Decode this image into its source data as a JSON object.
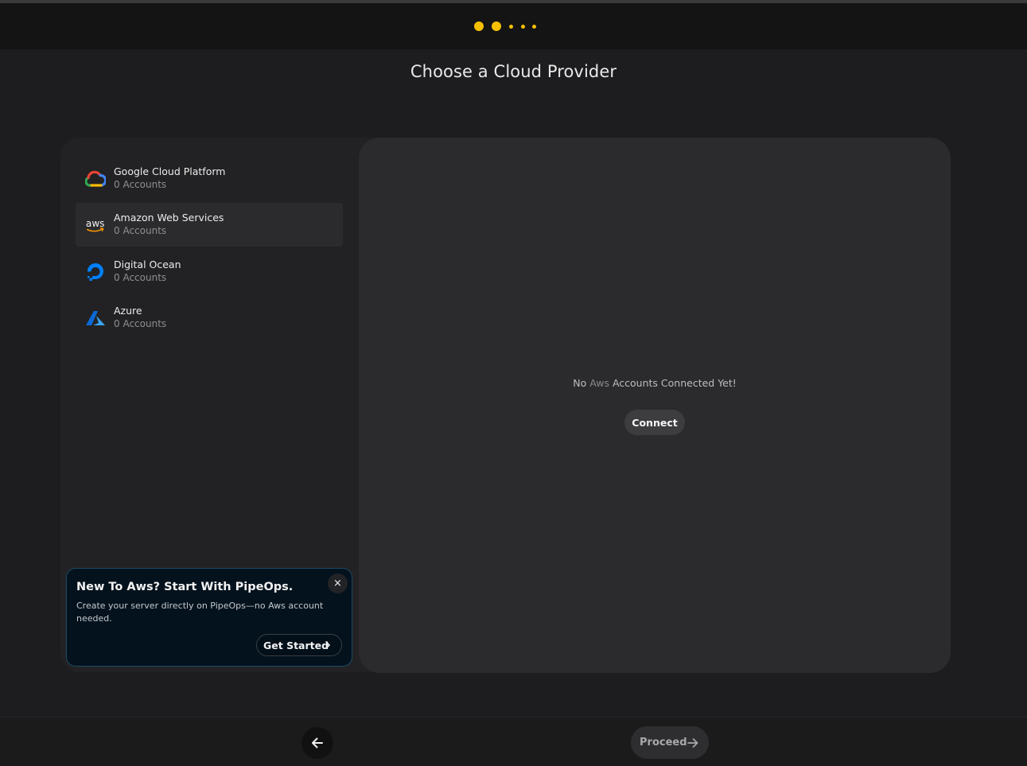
{
  "stepper": {
    "total_steps": 5,
    "completed_steps": 2
  },
  "page": {
    "title": "Choose a Cloud Provider"
  },
  "providers": [
    {
      "name": "Google Cloud Platform",
      "accounts": "0 Accounts",
      "icon": "google-cloud-icon",
      "active": false
    },
    {
      "name": "Amazon Web Services",
      "accounts": "0 Accounts",
      "icon": "aws-icon",
      "logo_text": "aws",
      "active": true
    },
    {
      "name": "Digital Ocean",
      "accounts": "0 Accounts",
      "icon": "digitalocean-icon",
      "active": false
    },
    {
      "name": "Azure",
      "accounts": "0 Accounts",
      "icon": "azure-icon",
      "active": false
    }
  ],
  "promo": {
    "title": "New To Aws? Start With PipeOps.",
    "description": "Create your server directly on PipeOps—no Aws account needed.",
    "cta_label": "Get Started",
    "close_label": "×"
  },
  "empty_state": {
    "prefix": "No ",
    "provider": "Aws",
    "suffix": " Accounts Connected Yet!",
    "connect_label": "Connect"
  },
  "footer": {
    "proceed_label": "Proceed"
  },
  "colors": {
    "accent": "#f5c000",
    "background": "#1d1d1f",
    "panel": "#2b2b2d",
    "promo_bg": "#04121d",
    "promo_border": "#1a4a64"
  }
}
